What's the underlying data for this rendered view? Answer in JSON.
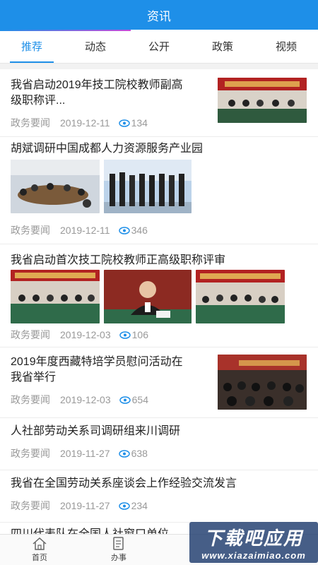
{
  "header": {
    "title": "资讯"
  },
  "tabs": [
    {
      "label": "推荐",
      "active": true
    },
    {
      "label": "动态",
      "active": false
    },
    {
      "label": "公开",
      "active": false
    },
    {
      "label": "政策",
      "active": false
    },
    {
      "label": "视频",
      "active": false
    }
  ],
  "articles": [
    {
      "title_line1": "我省启动2019年技工院校教师副高",
      "title_line2": "级职称评...",
      "source": "政务要闻",
      "date": "2019-12-11",
      "views": "134"
    },
    {
      "title_line1": "胡斌调研中国成都人力资源服务产业园",
      "source": "政务要闻",
      "date": "2019-12-11",
      "views": "346"
    },
    {
      "title_line1": "我省启动首次技工院校教师正高级职称评审",
      "source": "政务要闻",
      "date": "2019-12-03",
      "views": "106"
    },
    {
      "title_line1": "2019年度西藏特培学员慰问活动在",
      "title_line2": "我省举行",
      "source": "政务要闻",
      "date": "2019-12-03",
      "views": "654"
    },
    {
      "title_line1": "人社部劳动关系司调研组来川调研",
      "source": "政务要闻",
      "date": "2019-11-27",
      "views": "638"
    },
    {
      "title_line1": "我省在全国劳动关系座谈会上作经验交流发言",
      "source": "政务要闻",
      "date": "2019-11-27",
      "views": "234"
    },
    {
      "title_line1": "四川代表队在全国人社窗口单位..."
    }
  ],
  "tabbar": [
    {
      "label": "首页",
      "icon": "home-icon"
    },
    {
      "label": "办事",
      "icon": "document-icon"
    }
  ],
  "watermark": {
    "main": "下载吧应用",
    "sub": "www.xiazaimiao.com"
  },
  "colors": {
    "primary": "#1e8fe8",
    "meta": "#999999"
  }
}
